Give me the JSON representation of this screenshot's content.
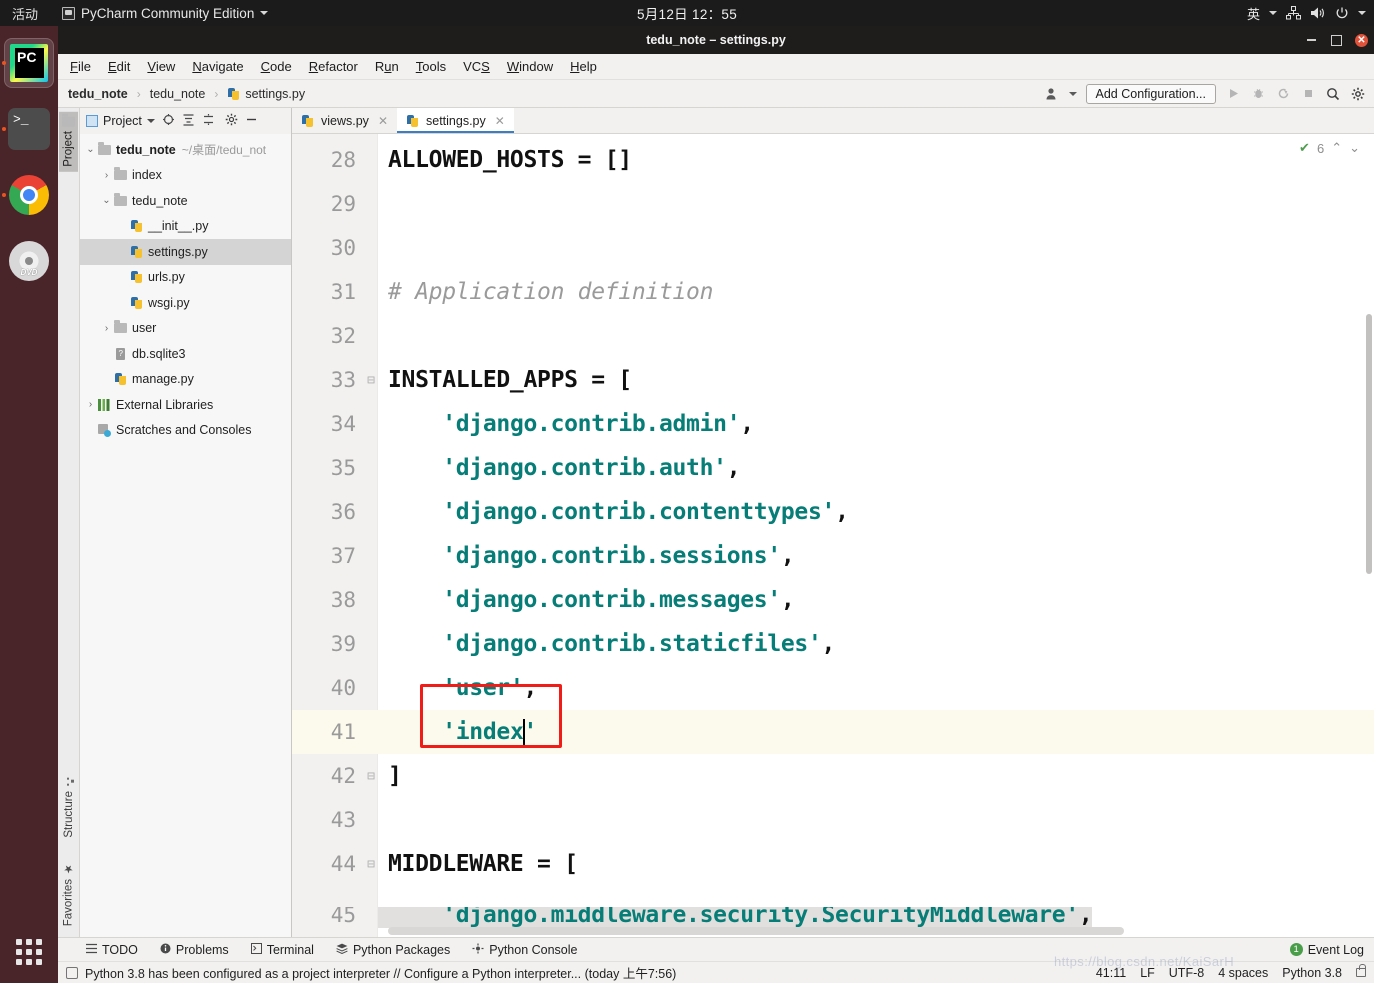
{
  "desktop": {
    "activities": "活动",
    "app_menu": "PyCharm Community Edition",
    "clock": "5月12日  12：55",
    "input_method": "英",
    "dock": [
      {
        "name": "pycharm",
        "label": "PyCharm"
      },
      {
        "name": "terminal",
        "label": "Terminal"
      },
      {
        "name": "chrome",
        "label": "Google Chrome"
      },
      {
        "name": "dvd",
        "label": "DVD"
      }
    ],
    "dvd_label": "DVD",
    "terminal_glyph": ">_"
  },
  "window": {
    "title": "tedu_note – settings.py"
  },
  "menubar": [
    {
      "pre": "",
      "mn": "F",
      "post": "ile"
    },
    {
      "pre": "",
      "mn": "E",
      "post": "dit"
    },
    {
      "pre": "",
      "mn": "V",
      "post": "iew"
    },
    {
      "pre": "",
      "mn": "N",
      "post": "avigate"
    },
    {
      "pre": "",
      "mn": "C",
      "post": "ode"
    },
    {
      "pre": "",
      "mn": "R",
      "post": "efactor"
    },
    {
      "pre": "R",
      "mn": "u",
      "post": "n"
    },
    {
      "pre": "",
      "mn": "T",
      "post": "ools"
    },
    {
      "pre": "VC",
      "mn": "S",
      "post": ""
    },
    {
      "pre": "",
      "mn": "W",
      "post": "indow"
    },
    {
      "pre": "",
      "mn": "H",
      "post": "elp"
    }
  ],
  "navbar": {
    "breadcrumb": [
      "tedu_note",
      "tedu_note",
      "settings.py"
    ],
    "add_configuration": "Add Configuration..."
  },
  "project_panel": {
    "title": "Project",
    "tree": [
      {
        "depth": 0,
        "arrow": "v",
        "icon": "folder",
        "label": "tedu_note",
        "bold": true,
        "path": "~/桌面/tedu_not",
        "selected": false
      },
      {
        "depth": 1,
        "arrow": ">",
        "icon": "folder",
        "label": "index",
        "bold": false,
        "path": "",
        "selected": false
      },
      {
        "depth": 1,
        "arrow": "v",
        "icon": "folder",
        "label": "tedu_note",
        "bold": false,
        "path": "",
        "selected": false
      },
      {
        "depth": 2,
        "arrow": "",
        "icon": "py",
        "label": "__init__.py",
        "bold": false,
        "path": "",
        "selected": false
      },
      {
        "depth": 2,
        "arrow": "",
        "icon": "py",
        "label": "settings.py",
        "bold": false,
        "path": "",
        "selected": true
      },
      {
        "depth": 2,
        "arrow": "",
        "icon": "py",
        "label": "urls.py",
        "bold": false,
        "path": "",
        "selected": false
      },
      {
        "depth": 2,
        "arrow": "",
        "icon": "py",
        "label": "wsgi.py",
        "bold": false,
        "path": "",
        "selected": false
      },
      {
        "depth": 1,
        "arrow": ">",
        "icon": "folder",
        "label": "user",
        "bold": false,
        "path": "",
        "selected": false
      },
      {
        "depth": 1,
        "arrow": "",
        "icon": "db",
        "label": "db.sqlite3",
        "bold": false,
        "path": "",
        "selected": false
      },
      {
        "depth": 1,
        "arrow": "",
        "icon": "py",
        "label": "manage.py",
        "bold": false,
        "path": "",
        "selected": false
      },
      {
        "depth": 0,
        "arrow": ">",
        "icon": "lib",
        "label": "External Libraries",
        "bold": false,
        "path": "",
        "selected": false
      },
      {
        "depth": 0,
        "arrow": "",
        "icon": "scratch",
        "label": "Scratches and Consoles",
        "bold": false,
        "path": "",
        "selected": false
      }
    ]
  },
  "left_stripe": {
    "top_tab": "Project",
    "bottom_tabs": [
      "Structure",
      "Favorites"
    ]
  },
  "editor": {
    "tabs": [
      {
        "label": "views.py",
        "active": false
      },
      {
        "label": "settings.py",
        "active": true
      }
    ],
    "inspection_count": "6",
    "lines": [
      {
        "num": "28",
        "fold": "",
        "indent": 0,
        "code": "ALLOWED_HOSTS = []",
        "type": "code",
        "current": false
      },
      {
        "num": "29",
        "fold": "",
        "indent": 0,
        "code": "",
        "type": "code",
        "current": false
      },
      {
        "num": "30",
        "fold": "",
        "indent": 0,
        "code": "",
        "type": "code",
        "current": false
      },
      {
        "num": "31",
        "fold": "",
        "indent": 0,
        "code": "# Application definition",
        "type": "comment",
        "current": false
      },
      {
        "num": "32",
        "fold": "",
        "indent": 0,
        "code": "",
        "type": "code",
        "current": false
      },
      {
        "num": "33",
        "fold": "-",
        "indent": 0,
        "code": "INSTALLED_APPS = [",
        "type": "code",
        "current": false
      },
      {
        "num": "34",
        "fold": "",
        "indent": 1,
        "code": "'django.contrib.admin',",
        "type": "string",
        "current": false
      },
      {
        "num": "35",
        "fold": "",
        "indent": 1,
        "code": "'django.contrib.auth',",
        "type": "string",
        "current": false
      },
      {
        "num": "36",
        "fold": "",
        "indent": 1,
        "code": "'django.contrib.contenttypes',",
        "type": "string",
        "current": false
      },
      {
        "num": "37",
        "fold": "",
        "indent": 1,
        "code": "'django.contrib.sessions',",
        "type": "string",
        "current": false
      },
      {
        "num": "38",
        "fold": "",
        "indent": 1,
        "code": "'django.contrib.messages',",
        "type": "string",
        "current": false
      },
      {
        "num": "39",
        "fold": "",
        "indent": 1,
        "code": "'django.contrib.staticfiles',",
        "type": "string",
        "current": false
      },
      {
        "num": "40",
        "fold": "",
        "indent": 1,
        "code": "'user',",
        "type": "string",
        "current": false
      },
      {
        "num": "41",
        "fold": "",
        "indent": 1,
        "code": "'index'",
        "type": "string-caret",
        "current": true
      },
      {
        "num": "42",
        "fold": "-",
        "indent": 0,
        "code": "]",
        "type": "code",
        "current": false
      },
      {
        "num": "43",
        "fold": "",
        "indent": 0,
        "code": "",
        "type": "code",
        "current": false
      },
      {
        "num": "44",
        "fold": "-",
        "indent": 0,
        "code": "MIDDLEWARE = [",
        "type": "code",
        "current": false
      }
    ]
  },
  "toolwindows": [
    {
      "label": "TODO",
      "icon": "list-icon"
    },
    {
      "label": "Problems",
      "icon": "info-icon"
    },
    {
      "label": "Terminal",
      "icon": "terminal-icon"
    },
    {
      "label": "Python Packages",
      "icon": "packages-icon"
    },
    {
      "label": "Python Console",
      "icon": "console-icon"
    }
  ],
  "event_log": {
    "label": "Event Log",
    "count": "1"
  },
  "statusbar": {
    "message": "Python 3.8 has been configured as a project interpreter // Configure a Python interpreter... (today 上午7:56)",
    "caret_position": "41:11",
    "line_separator": "LF",
    "encoding": "UTF-8",
    "indent": "4 spaces",
    "interpreter": "Python 3.8"
  },
  "watermark": "https://blog.csdn.net/KaiSarH",
  "colors": {
    "accent": "#3c7ec1",
    "string": "#077d77",
    "annotation_box": "#f01c17",
    "current_line": "#fcfaed",
    "ubuntu_orange": "#e95420"
  }
}
